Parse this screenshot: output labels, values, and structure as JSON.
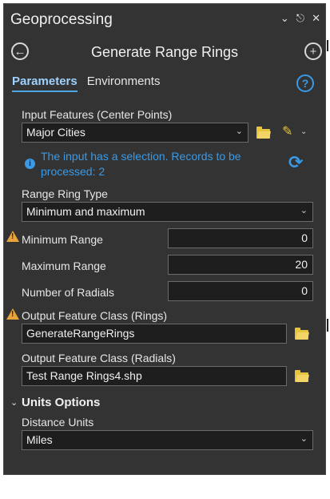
{
  "panel": {
    "title": "Geoprocessing",
    "icons": {
      "menu": "chevron-down-icon",
      "pin": "pin-icon",
      "close": "close-icon"
    }
  },
  "tool": {
    "name": "Generate Range Rings",
    "back_icon": "back-arrow-icon",
    "add_icon": "add-icon"
  },
  "tabs": [
    {
      "label": "Parameters",
      "active": true
    },
    {
      "label": "Environments",
      "active": false
    }
  ],
  "help_icon": "help-icon",
  "params": {
    "input_features": {
      "label": "Input Features (Center Points)",
      "value": "Major Cities"
    },
    "selection_info": "The input has a selection. Records to be processed: 2",
    "ring_type": {
      "label": "Range Ring Type",
      "value": "Minimum and maximum"
    },
    "min_range": {
      "label": "Minimum Range",
      "value": "0"
    },
    "max_range": {
      "label": "Maximum Range",
      "value": "20"
    },
    "num_radials": {
      "label": "Number of Radials",
      "value": "0"
    },
    "output_rings": {
      "label": "Output Feature Class (Rings)",
      "value": "GenerateRangeRings"
    },
    "output_radials": {
      "label": "Output Feature Class (Radials)",
      "value": "Test Range Rings4.shp"
    }
  },
  "units": {
    "section_label": "Units Options",
    "distance_label": "Distance Units",
    "distance_value": "Miles"
  },
  "colors": {
    "accent": "#3a9ae6",
    "warning": "#e8a33a",
    "folder": "#e8c43a",
    "panel_bg": "#333333"
  }
}
